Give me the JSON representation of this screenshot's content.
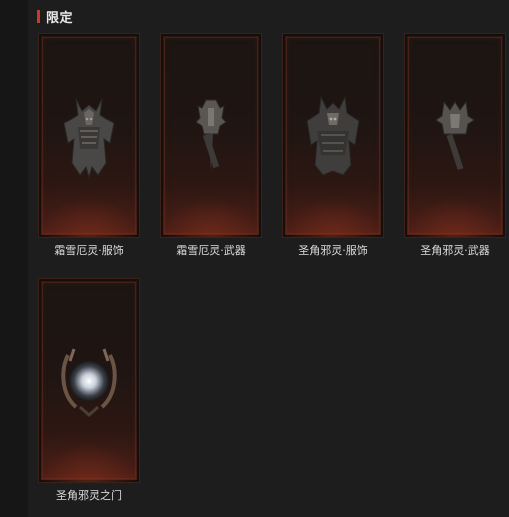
{
  "section": {
    "title": "限定",
    "accent_color": "#c83a2a"
  },
  "items": [
    {
      "label": "霜雪厄灵·服饰",
      "icon": "frost-demon-armor-icon"
    },
    {
      "label": "霜雪厄灵·武器",
      "icon": "frost-demon-weapon-icon"
    },
    {
      "label": "圣角邪灵·服饰",
      "icon": "horned-demon-armor-icon"
    },
    {
      "label": "圣角邪灵·武器",
      "icon": "horned-demon-weapon-icon"
    },
    {
      "label": "圣角邪灵之门",
      "icon": "horned-demon-portal-icon"
    }
  ]
}
